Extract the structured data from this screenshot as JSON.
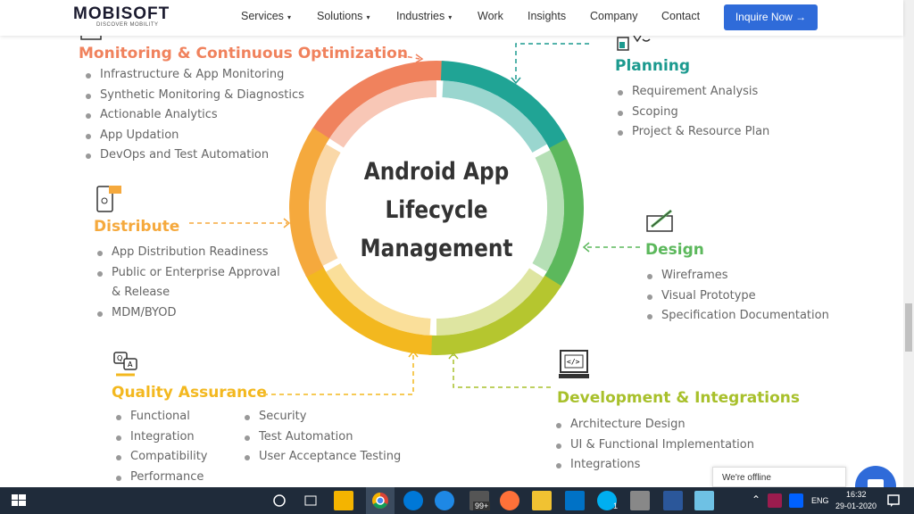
{
  "header": {
    "logo_main": "MOBISOFT",
    "logo_sub": "DISCOVER MOBILITY",
    "nav": [
      "Services",
      "Solutions",
      "Industries",
      "Work",
      "Insights",
      "Company",
      "Contact"
    ],
    "cta": "Inquire Now →"
  },
  "center": {
    "line1": "Android App",
    "line2": "Lifecycle",
    "line3": "Management"
  },
  "sections": {
    "monitoring": {
      "title": "Monitoring & Continuous Optimization",
      "color": "#f0825d",
      "items": [
        "Infrastructure & App Monitoring",
        "Synthetic Monitoring & Diagnostics",
        "Actionable Analytics",
        "App Updation",
        "DevOps and Test Automation"
      ]
    },
    "planning": {
      "title": "Planning",
      "color": "#1c9a8f",
      "items": [
        "Requirement Analysis",
        "Scoping",
        "Project & Resource Plan"
      ]
    },
    "distribute": {
      "title": "Distribute",
      "color": "#f5a93d",
      "items": [
        "App Distribution Readiness",
        "Public or Enterprise Approval & Release",
        "MDM/BYOD"
      ]
    },
    "design": {
      "title": "Design",
      "color": "#5cb85c",
      "items": [
        "Wireframes",
        "Visual Prototype",
        "Specification Documentation"
      ]
    },
    "qa": {
      "title": "Quality Assurance",
      "color": "#f3b81f",
      "col1": [
        "Functional",
        "Integration",
        "Compatibility",
        "Performance"
      ],
      "col2": [
        "Security",
        "Test Automation",
        "User Acceptance Testing"
      ]
    },
    "development": {
      "title": "Development & Integrations",
      "color": "#a8c02b",
      "items": [
        "Architecture Design",
        "UI & Functional Implementation",
        "Integrations"
      ]
    }
  },
  "chat": {
    "offline_text": "We're offline"
  },
  "taskbar": {
    "time": "16:32",
    "date": "29-01-2020",
    "lang": "ENG",
    "badge_99": "99+",
    "badge_1": "1"
  },
  "ring_colors": [
    "#f0825d",
    "#20a495",
    "#5cb85c",
    "#b5c62f",
    "#f3b81f",
    "#f5a93d"
  ]
}
